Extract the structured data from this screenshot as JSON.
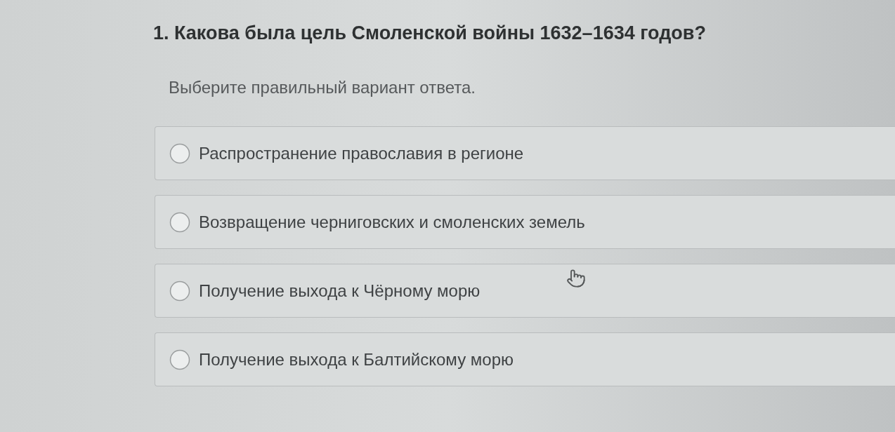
{
  "question": {
    "title": "1. Какова была цель Смоленской войны 1632–1634 годов?",
    "instruction": "Выберите правильный вариант ответа."
  },
  "options": [
    {
      "label": "Распространение православия в регионе",
      "selected": false
    },
    {
      "label": "Возвращение черниговских и смоленских земель",
      "selected": false
    },
    {
      "label": "Получение выхода к Чёрному морю",
      "selected": false
    },
    {
      "label": "Получение выхода к Балтийскому морю",
      "selected": false
    }
  ]
}
